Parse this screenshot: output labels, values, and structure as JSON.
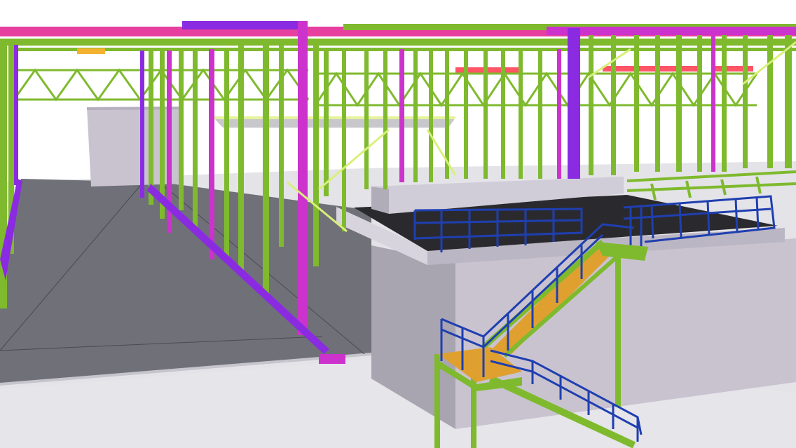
{
  "scene": {
    "kind": "3D steel structure model view",
    "elements": [
      "roof-beams",
      "roof-truss",
      "columns",
      "floor-slab",
      "pit-wall",
      "elevated-platform",
      "handrails",
      "stair-flight",
      "stair-landing",
      "mezzanine-deck"
    ]
  },
  "colors": {
    "background": "#ffffff",
    "floor": "#707078",
    "wall": "#c9c3d0",
    "steel_green": "#7fba2e",
    "steel_magenta": "#cc33cc",
    "steel_pink": "#e63fa0",
    "steel_purple": "#8a2be2",
    "handrail_blue": "#1f3fb0",
    "stair_tread": "#e0a030",
    "slab_dark": "#2a2a2e",
    "red_accent": "#ff5566"
  }
}
